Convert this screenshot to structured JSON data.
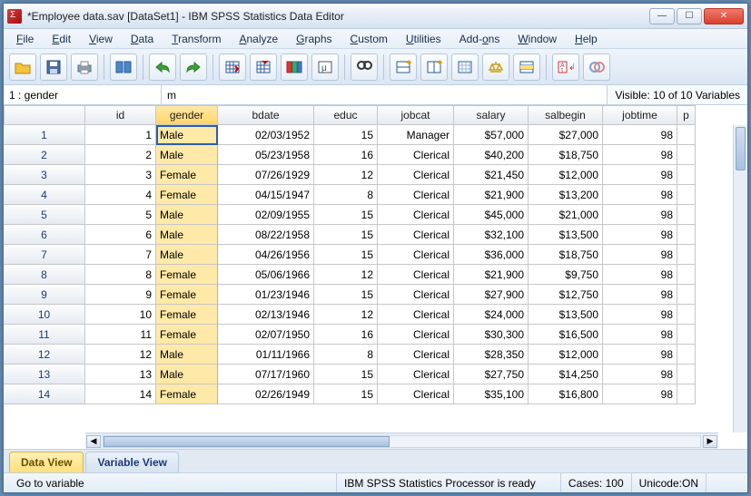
{
  "window": {
    "title": "*Employee data.sav [DataSet1] - IBM SPSS Statistics Data Editor"
  },
  "menu": {
    "file": "File",
    "edit": "Edit",
    "view": "View",
    "data": "Data",
    "transform": "Transform",
    "analyze": "Analyze",
    "graphs": "Graphs",
    "custom": "Custom",
    "utilities": "Utilities",
    "addons": "Add-ons",
    "window": "Window",
    "help": "Help"
  },
  "infobar": {
    "cellref": "1 : gender",
    "cellval": "m",
    "visible": "Visible: 10 of 10 Variables"
  },
  "columns": [
    "id",
    "gender",
    "bdate",
    "educ",
    "jobcat",
    "salary",
    "salbegin",
    "jobtime",
    "p"
  ],
  "rows": [
    {
      "n": "1",
      "id": "1",
      "gender": "Male",
      "bdate": "02/03/1952",
      "educ": "15",
      "jobcat": "Manager",
      "salary": "$57,000",
      "salbegin": "$27,000",
      "jobtime": "98"
    },
    {
      "n": "2",
      "id": "2",
      "gender": "Male",
      "bdate": "05/23/1958",
      "educ": "16",
      "jobcat": "Clerical",
      "salary": "$40,200",
      "salbegin": "$18,750",
      "jobtime": "98"
    },
    {
      "n": "3",
      "id": "3",
      "gender": "Female",
      "bdate": "07/26/1929",
      "educ": "12",
      "jobcat": "Clerical",
      "salary": "$21,450",
      "salbegin": "$12,000",
      "jobtime": "98"
    },
    {
      "n": "4",
      "id": "4",
      "gender": "Female",
      "bdate": "04/15/1947",
      "educ": "8",
      "jobcat": "Clerical",
      "salary": "$21,900",
      "salbegin": "$13,200",
      "jobtime": "98"
    },
    {
      "n": "5",
      "id": "5",
      "gender": "Male",
      "bdate": "02/09/1955",
      "educ": "15",
      "jobcat": "Clerical",
      "salary": "$45,000",
      "salbegin": "$21,000",
      "jobtime": "98"
    },
    {
      "n": "6",
      "id": "6",
      "gender": "Male",
      "bdate": "08/22/1958",
      "educ": "15",
      "jobcat": "Clerical",
      "salary": "$32,100",
      "salbegin": "$13,500",
      "jobtime": "98"
    },
    {
      "n": "7",
      "id": "7",
      "gender": "Male",
      "bdate": "04/26/1956",
      "educ": "15",
      "jobcat": "Clerical",
      "salary": "$36,000",
      "salbegin": "$18,750",
      "jobtime": "98"
    },
    {
      "n": "8",
      "id": "8",
      "gender": "Female",
      "bdate": "05/06/1966",
      "educ": "12",
      "jobcat": "Clerical",
      "salary": "$21,900",
      "salbegin": "$9,750",
      "jobtime": "98"
    },
    {
      "n": "9",
      "id": "9",
      "gender": "Female",
      "bdate": "01/23/1946",
      "educ": "15",
      "jobcat": "Clerical",
      "salary": "$27,900",
      "salbegin": "$12,750",
      "jobtime": "98"
    },
    {
      "n": "10",
      "id": "10",
      "gender": "Female",
      "bdate": "02/13/1946",
      "educ": "12",
      "jobcat": "Clerical",
      "salary": "$24,000",
      "salbegin": "$13,500",
      "jobtime": "98"
    },
    {
      "n": "11",
      "id": "11",
      "gender": "Female",
      "bdate": "02/07/1950",
      "educ": "16",
      "jobcat": "Clerical",
      "salary": "$30,300",
      "salbegin": "$16,500",
      "jobtime": "98"
    },
    {
      "n": "12",
      "id": "12",
      "gender": "Male",
      "bdate": "01/11/1966",
      "educ": "8",
      "jobcat": "Clerical",
      "salary": "$28,350",
      "salbegin": "$12,000",
      "jobtime": "98"
    },
    {
      "n": "13",
      "id": "13",
      "gender": "Male",
      "bdate": "07/17/1960",
      "educ": "15",
      "jobcat": "Clerical",
      "salary": "$27,750",
      "salbegin": "$14,250",
      "jobtime": "98"
    },
    {
      "n": "14",
      "id": "14",
      "gender": "Female",
      "bdate": "02/26/1949",
      "educ": "15",
      "jobcat": "Clerical",
      "salary": "$35,100",
      "salbegin": "$16,800",
      "jobtime": "98"
    }
  ],
  "tabs": {
    "data": "Data View",
    "variable": "Variable View"
  },
  "status": {
    "goto": "Go to variable",
    "processor": "IBM SPSS Statistics Processor is ready",
    "cases": "Cases: 100",
    "unicode": "Unicode:ON"
  }
}
